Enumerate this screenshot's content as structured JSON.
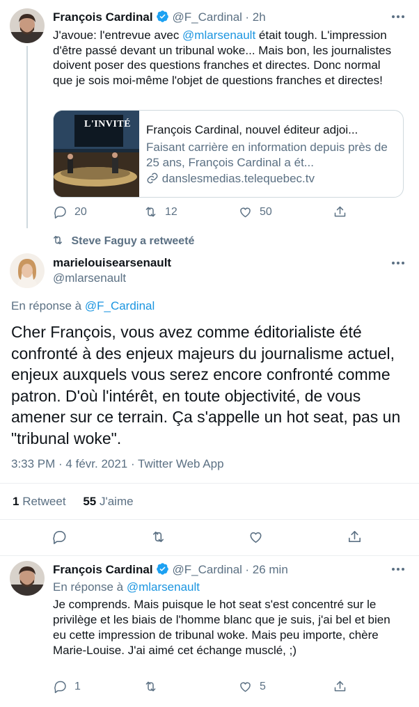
{
  "tweet1": {
    "author_name": "François Cardinal",
    "handle": "@F_Cardinal",
    "time": "2h",
    "text_part1": "J'avoue: l'entrevue avec ",
    "mention": "@mlarsenault",
    "text_part2": " était tough. L'impression d'être passé devant un tribunal woke... Mais bon, les journalistes doivent poser des questions franches et directes. Donc normal que je sois moi-même l'objet de questions franches et directes!",
    "card": {
      "thumb_text": "L'INVITÉ",
      "title": "François Cardinal, nouvel éditeur adjoi...",
      "description": "Faisant carrière en information depuis près de 25 ans, François Cardinal a ét...",
      "domain": "danslesmedias.telequebec.tv"
    },
    "replies": "20",
    "retweets": "12",
    "likes": "50"
  },
  "retweet_context": "Steve Faguy a retweeté",
  "tweet2": {
    "author_name": "marielouisearsenault",
    "handle": "@mlarsenault",
    "reply_prefix": "En réponse à ",
    "reply_to": "@F_Cardinal",
    "text": "Cher François, vous avez comme éditorialiste été confronté  à des enjeux majeurs du journalisme actuel, enjeux auxquels vous serez encore confronté comme patron. D'où l'intérêt, en toute objectivité, de vous amener sur ce terrain. Ça s'appelle un hot seat, pas un \"tribunal woke\".",
    "meta": "3:33 PM · 4 févr. 2021 · Twitter Web App",
    "retweet_count": "1",
    "retweet_label": "Retweet",
    "like_count": "55",
    "like_label": "J'aime"
  },
  "tweet3": {
    "author_name": "François Cardinal",
    "handle": "@F_Cardinal",
    "time": "26 min",
    "reply_prefix": "En réponse à ",
    "reply_to": "@mlarsenault",
    "text": "Je comprends. Mais puisque le hot seat s'est concentré sur le privilège et les biais de l'homme blanc que je suis, j'ai bel et bien eu cette impression de tribunal woke. Mais peu importe, chère Marie-Louise. J'ai aimé cet échange musclé,  ;)",
    "replies": "1",
    "likes": "5"
  },
  "colors": {
    "link": "#1b95e0",
    "muted": "#5b7083",
    "verified": "#1da1f2",
    "divider": "#ebeef0"
  },
  "icons": [
    "reply-icon",
    "retweet-icon",
    "like-icon",
    "share-icon",
    "verified-badge-icon",
    "more-icon",
    "link-icon"
  ]
}
